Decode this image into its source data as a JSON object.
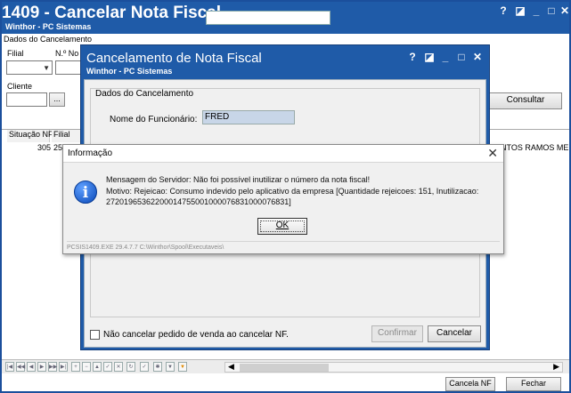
{
  "main_window": {
    "title": "1409 - Cancelar Nota Fiscal",
    "subtitle": "Winthor - PC Sistemas",
    "controls": [
      "?",
      "◪",
      "_",
      "□",
      "✕"
    ],
    "section_label": "Dados do Cancelamento",
    "filial_label": "Filial",
    "nota_label": "N.º No",
    "cliente_label": "Cliente",
    "ellipsis_label": "...",
    "consultar_label": "Consultar",
    "grid": {
      "headers": [
        "Situação NF",
        "Filial"
      ],
      "row": {
        "situacao": "305",
        "filial": "25"
      },
      "right_text": "SANTOS RAMOS ME"
    },
    "cancela_nf_label": "Cancela NF",
    "fechar_label": "Fechar"
  },
  "cancel_dialog": {
    "title": "Cancelamento de Nota Fiscal",
    "subtitle": "Winthor - PC Sistemas",
    "controls": [
      "?",
      "◪",
      "_",
      "□",
      "✕"
    ],
    "legend": "Dados do Cancelamento",
    "funcionario_label": "Nome do Funcionário:",
    "funcionario_value": "FRED",
    "checkbox_label": "Não cancelar pedido de venda ao cancelar NF.",
    "confirmar_label": "Confirmar",
    "cancelar_label": "Cancelar"
  },
  "message_box": {
    "title": "Informação",
    "close": "✕",
    "icon": "info-icon",
    "line1": "Mensagem do Servidor: Não foi possível inutilizar o número da nota fiscal!",
    "line2": "Motivo: Rejeicao: Consumo indevido pelo aplicativo da empresa [Quantidade rejeicoes: 151, Inutilizacao:",
    "line3": "27201965362200014755001000076831000076831]",
    "ok_label": "OK",
    "path": "PCSIS1409.EXE 29.4.7.7 C:\\Winthor\\Spool\\Executaveis\\"
  },
  "colors": {
    "title_blue": "#1f5ba8",
    "dialog_bg": "#f0f0f0"
  }
}
